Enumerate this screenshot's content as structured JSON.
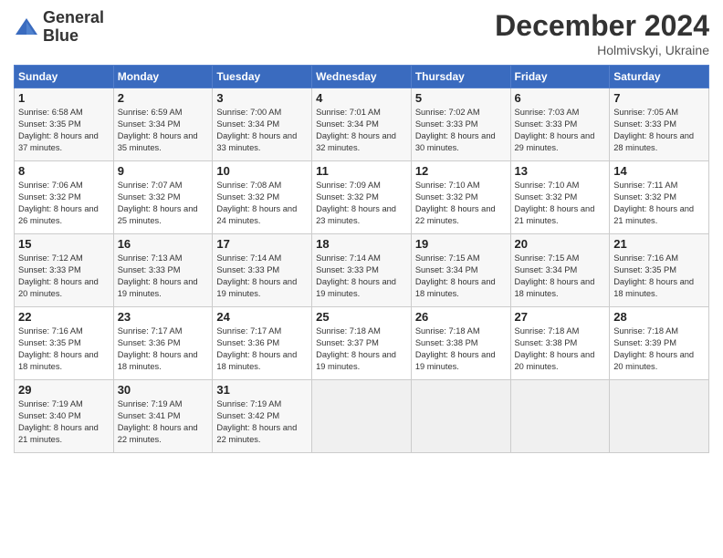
{
  "header": {
    "logo_line1": "General",
    "logo_line2": "Blue",
    "month": "December 2024",
    "location": "Holmivskyi, Ukraine"
  },
  "days_of_week": [
    "Sunday",
    "Monday",
    "Tuesday",
    "Wednesday",
    "Thursday",
    "Friday",
    "Saturday"
  ],
  "weeks": [
    [
      {
        "day": "1",
        "text": "Sunrise: 6:58 AM\nSunset: 3:35 PM\nDaylight: 8 hours\nand 37 minutes."
      },
      {
        "day": "2",
        "text": "Sunrise: 6:59 AM\nSunset: 3:34 PM\nDaylight: 8 hours\nand 35 minutes."
      },
      {
        "day": "3",
        "text": "Sunrise: 7:00 AM\nSunset: 3:34 PM\nDaylight: 8 hours\nand 33 minutes."
      },
      {
        "day": "4",
        "text": "Sunrise: 7:01 AM\nSunset: 3:34 PM\nDaylight: 8 hours\nand 32 minutes."
      },
      {
        "day": "5",
        "text": "Sunrise: 7:02 AM\nSunset: 3:33 PM\nDaylight: 8 hours\nand 30 minutes."
      },
      {
        "day": "6",
        "text": "Sunrise: 7:03 AM\nSunset: 3:33 PM\nDaylight: 8 hours\nand 29 minutes."
      },
      {
        "day": "7",
        "text": "Sunrise: 7:05 AM\nSunset: 3:33 PM\nDaylight: 8 hours\nand 28 minutes."
      }
    ],
    [
      {
        "day": "8",
        "text": "Sunrise: 7:06 AM\nSunset: 3:32 PM\nDaylight: 8 hours\nand 26 minutes."
      },
      {
        "day": "9",
        "text": "Sunrise: 7:07 AM\nSunset: 3:32 PM\nDaylight: 8 hours\nand 25 minutes."
      },
      {
        "day": "10",
        "text": "Sunrise: 7:08 AM\nSunset: 3:32 PM\nDaylight: 8 hours\nand 24 minutes."
      },
      {
        "day": "11",
        "text": "Sunrise: 7:09 AM\nSunset: 3:32 PM\nDaylight: 8 hours\nand 23 minutes."
      },
      {
        "day": "12",
        "text": "Sunrise: 7:10 AM\nSunset: 3:32 PM\nDaylight: 8 hours\nand 22 minutes."
      },
      {
        "day": "13",
        "text": "Sunrise: 7:10 AM\nSunset: 3:32 PM\nDaylight: 8 hours\nand 21 minutes."
      },
      {
        "day": "14",
        "text": "Sunrise: 7:11 AM\nSunset: 3:32 PM\nDaylight: 8 hours\nand 21 minutes."
      }
    ],
    [
      {
        "day": "15",
        "text": "Sunrise: 7:12 AM\nSunset: 3:33 PM\nDaylight: 8 hours\nand 20 minutes."
      },
      {
        "day": "16",
        "text": "Sunrise: 7:13 AM\nSunset: 3:33 PM\nDaylight: 8 hours\nand 19 minutes."
      },
      {
        "day": "17",
        "text": "Sunrise: 7:14 AM\nSunset: 3:33 PM\nDaylight: 8 hours\nand 19 minutes."
      },
      {
        "day": "18",
        "text": "Sunrise: 7:14 AM\nSunset: 3:33 PM\nDaylight: 8 hours\nand 19 minutes."
      },
      {
        "day": "19",
        "text": "Sunrise: 7:15 AM\nSunset: 3:34 PM\nDaylight: 8 hours\nand 18 minutes."
      },
      {
        "day": "20",
        "text": "Sunrise: 7:15 AM\nSunset: 3:34 PM\nDaylight: 8 hours\nand 18 minutes."
      },
      {
        "day": "21",
        "text": "Sunrise: 7:16 AM\nSunset: 3:35 PM\nDaylight: 8 hours\nand 18 minutes."
      }
    ],
    [
      {
        "day": "22",
        "text": "Sunrise: 7:16 AM\nSunset: 3:35 PM\nDaylight: 8 hours\nand 18 minutes."
      },
      {
        "day": "23",
        "text": "Sunrise: 7:17 AM\nSunset: 3:36 PM\nDaylight: 8 hours\nand 18 minutes."
      },
      {
        "day": "24",
        "text": "Sunrise: 7:17 AM\nSunset: 3:36 PM\nDaylight: 8 hours\nand 18 minutes."
      },
      {
        "day": "25",
        "text": "Sunrise: 7:18 AM\nSunset: 3:37 PM\nDaylight: 8 hours\nand 19 minutes."
      },
      {
        "day": "26",
        "text": "Sunrise: 7:18 AM\nSunset: 3:38 PM\nDaylight: 8 hours\nand 19 minutes."
      },
      {
        "day": "27",
        "text": "Sunrise: 7:18 AM\nSunset: 3:38 PM\nDaylight: 8 hours\nand 20 minutes."
      },
      {
        "day": "28",
        "text": "Sunrise: 7:18 AM\nSunset: 3:39 PM\nDaylight: 8 hours\nand 20 minutes."
      }
    ],
    [
      {
        "day": "29",
        "text": "Sunrise: 7:19 AM\nSunset: 3:40 PM\nDaylight: 8 hours\nand 21 minutes."
      },
      {
        "day": "30",
        "text": "Sunrise: 7:19 AM\nSunset: 3:41 PM\nDaylight: 8 hours\nand 22 minutes."
      },
      {
        "day": "31",
        "text": "Sunrise: 7:19 AM\nSunset: 3:42 PM\nDaylight: 8 hours\nand 22 minutes."
      },
      {
        "day": "",
        "text": ""
      },
      {
        "day": "",
        "text": ""
      },
      {
        "day": "",
        "text": ""
      },
      {
        "day": "",
        "text": ""
      }
    ]
  ]
}
